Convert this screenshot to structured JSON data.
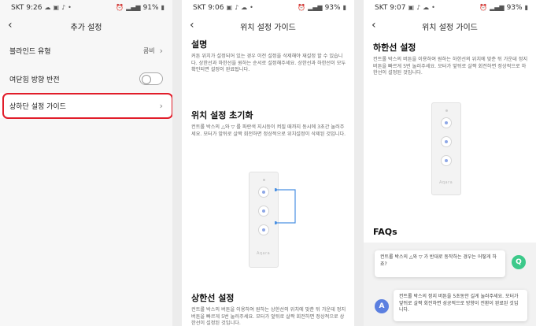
{
  "screen1": {
    "status": {
      "time": "SKT 9:26",
      "battery": "91%"
    },
    "title": "추가 설정",
    "rows": [
      {
        "label": "블라인드 유형",
        "value": "콤비"
      },
      {
        "label": "여닫힘 방향 반전"
      },
      {
        "label": "상하단 설정 가이드"
      }
    ],
    "highlight_color": "#e11d2a"
  },
  "screen2": {
    "status": {
      "time": "SKT 9:06",
      "battery": "93%"
    },
    "title": "위치 설정 가이드",
    "intro_heading": "설명",
    "intro_text": "커튼 위치가 설정되어 있는 경우 이전 설정을 삭제해야 재설정 할 수 있습니다. 상한선과 하한선을 원하는 순서로 설정해주세요. 상한선과 하한선이 모두 확인되면 설정이 완료됩니다.",
    "reset_heading": "위치 설정 초기화",
    "reset_text": "컨트롤 박스의 △와 ▽ 를 파란색 지시등이 켜질 때까지 동시에 3초간 눌러주세요. 모터가 앞뒤로 살짝 회전하면 정상적으로 위치설정이 삭제된 것입니다.",
    "device_logo": "Aqara",
    "upper_heading": "상한선 설정",
    "upper_text": "컨트롤 박스의 버튼을 이용하여 원하는 상한선의 위치에 맞춘 뒤 가운데 정지 버튼을 빠르게 5번 눌러주세요. 모터가 앞뒤로 살짝 회전하면 정상적으로 상한선이 설정된 것입니다."
  },
  "screen3": {
    "status": {
      "time": "SKT 9:07",
      "battery": "93%"
    },
    "title": "위치 설정 가이드",
    "lower_heading": "하한선 설정",
    "lower_text": "컨트롤 박스의 버튼을 이용하여 원하는 하한선의 위치에 맞춘 뒤 가운데 정지 버튼을 빠르게 5번 눌러주세요. 모터가 앞뒤로 살짝 회전하면 정상적으로 하한선이 설정된 것입니다.",
    "device_logo": "Aqara",
    "faq_heading": "FAQs",
    "question_badge": "Q",
    "question": "컨트롤 박스의 △와 ▽ 가 반대로 동작하는 경우는 어떻게 하죠?",
    "answer_badge": "A",
    "answer": "컨트롤 박스의 정지 버튼을 5초동안 길게 눌러주세요. 모터가 앞뒤로 살짝 회전하면 성공적으로 방향이 전환이 완료된 것입니다.",
    "q_color": "#3cc98a",
    "a_color": "#5b7fe0"
  }
}
